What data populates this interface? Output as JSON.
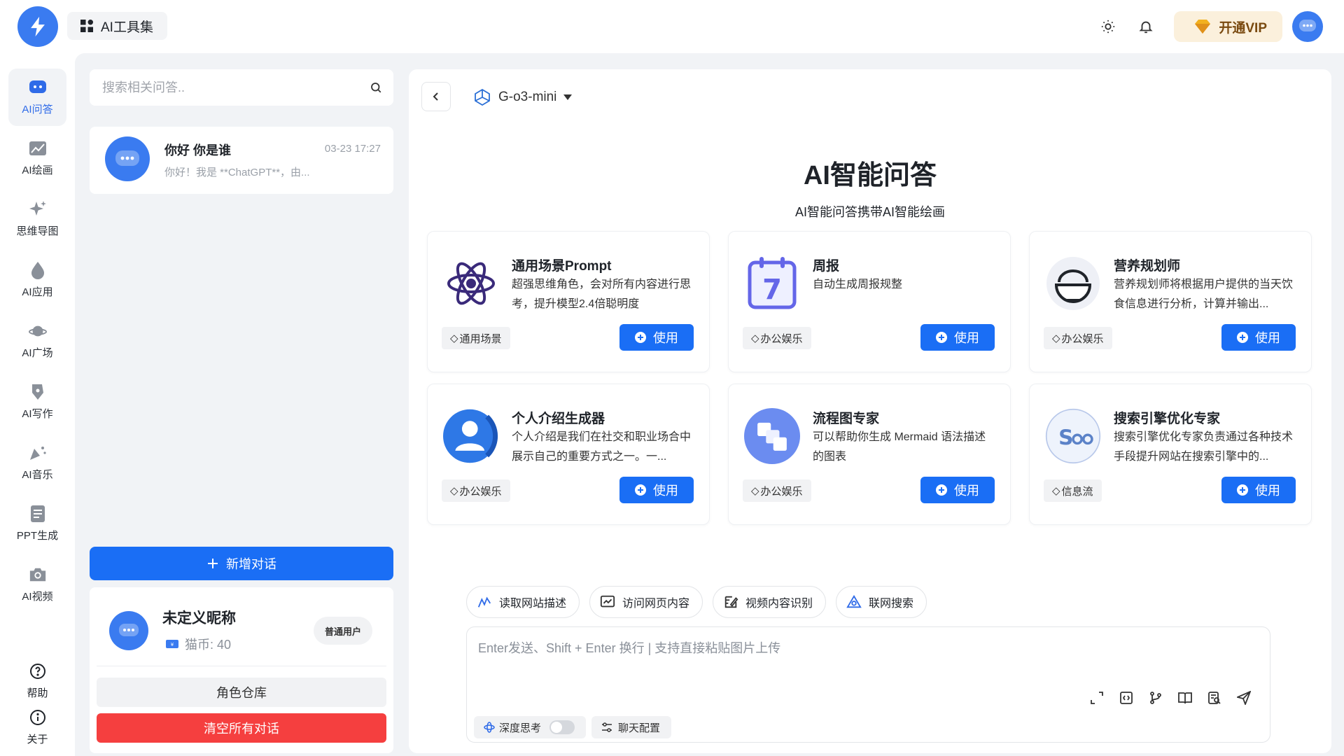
{
  "app": {
    "tools_label": "AI工具集",
    "vip_label": "开通VIP"
  },
  "nav": {
    "items": [
      {
        "label": "AI问答",
        "icon": "chat-bubble-icon",
        "active": true
      },
      {
        "label": "AI绘画",
        "icon": "image-icon"
      },
      {
        "label": "思维导图",
        "icon": "sparkle-icon"
      },
      {
        "label": "AI应用",
        "icon": "drop-icon"
      },
      {
        "label": "AI广场",
        "icon": "planet-icon"
      },
      {
        "label": "AI写作",
        "icon": "pen-icon"
      },
      {
        "label": "AI音乐",
        "icon": "music-icon"
      },
      {
        "label": "PPT生成",
        "icon": "document-icon"
      },
      {
        "label": "AI视频",
        "icon": "camera-icon"
      }
    ],
    "help_label": "帮助",
    "about_label": "关于"
  },
  "sidebar": {
    "search_placeholder": "搜索相关问答..",
    "conversations": [
      {
        "title": "你好 你是谁",
        "time": "03-23 17:27",
        "preview": "你好！我是 **ChatGPT**，由..."
      }
    ],
    "new_chat_label": "新增对话",
    "user": {
      "name": "未定义昵称",
      "coin_label": "猫币: 40",
      "role": "普通用户"
    },
    "role_library_label": "角色仓库",
    "clear_label": "清空所有对话"
  },
  "main": {
    "model_name": "G-o3-mini",
    "title": "AI智能问答",
    "subtitle": "AI智能问答携带AI智能绘画",
    "use_label": "使用",
    "cards": [
      {
        "title": "通用场景Prompt",
        "desc": "超强思维角色，会对所有内容进行思考，提升模型2.4倍聪明度",
        "tag": "通用场景",
        "icon": "atom-icon"
      },
      {
        "title": "周报",
        "desc": "自动生成周报规整",
        "tag": "办公娱乐",
        "icon": "calendar-icon"
      },
      {
        "title": "营养规划师",
        "desc": "营养规划师将根据用户提供的当天饮食信息进行分析，计算并输出...",
        "tag": "办公娱乐",
        "icon": "bowl-icon"
      },
      {
        "title": "个人介绍生成器",
        "desc": "个人介绍是我们在社交和职业场合中展示自己的重要方式之一。一...",
        "tag": "办公娱乐",
        "icon": "person-icon"
      },
      {
        "title": "流程图专家",
        "desc": "可以帮助你生成 Mermaid 语法描述的图表",
        "tag": "办公娱乐",
        "icon": "flowchart-icon"
      },
      {
        "title": "搜索引擎优化专家",
        "desc": "搜索引擎优化专家负责通过各种技术手段提升网站在搜索引擎中的...",
        "tag": "信息流",
        "icon": "seo-icon"
      }
    ],
    "chips": [
      {
        "label": "读取网站描述",
        "icon": "link-icon"
      },
      {
        "label": "访问网页内容",
        "icon": "webpage-icon"
      },
      {
        "label": "视频内容识别",
        "icon": "edit-icon"
      },
      {
        "label": "联网搜索",
        "icon": "network-icon"
      }
    ],
    "input_placeholder": "Enter发送、Shift + Enter 换行 | 支持直接粘贴图片上传",
    "deep_think_label": "深度思考",
    "deep_think_on": false,
    "chat_config_label": "聊天配置"
  },
  "colors": {
    "primary": "#1a6ef5",
    "danger": "#f53f3f",
    "workspace_bg": "#f1f3f6"
  }
}
